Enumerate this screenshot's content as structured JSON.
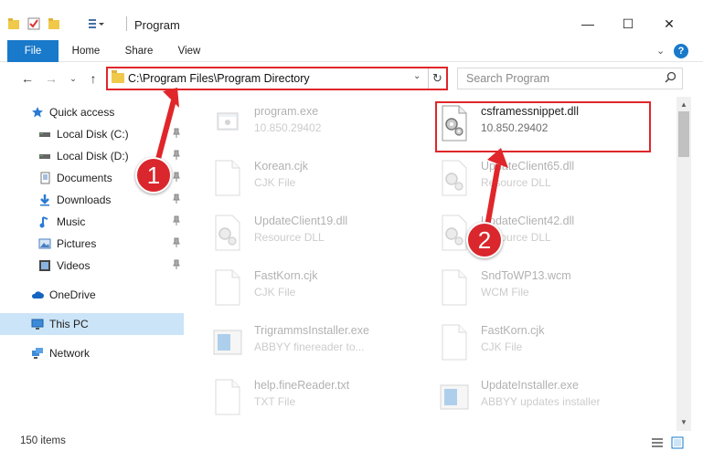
{
  "window": {
    "title": "Program",
    "controls": {
      "minimize": "—",
      "maximize": "☐",
      "close": "✕"
    }
  },
  "ribbon": {
    "tabs": [
      {
        "label": "File"
      },
      {
        "label": "Home"
      },
      {
        "label": "Share"
      },
      {
        "label": "View"
      }
    ],
    "help": "?"
  },
  "address_bar": {
    "path": "C:\\Program Files\\Program Directory"
  },
  "search": {
    "placeholder": "Search Program"
  },
  "sidebar": {
    "items": [
      {
        "label": "Quick access",
        "icon": "star-icon"
      },
      {
        "label": "Local Disk (C:)",
        "icon": "drive-icon",
        "pinned": true
      },
      {
        "label": "Local Disk (D:)",
        "icon": "drive-icon",
        "pinned": true
      },
      {
        "label": "Documents",
        "icon": "documents-icon",
        "pinned": true
      },
      {
        "label": "Downloads",
        "icon": "download-icon",
        "pinned": true
      },
      {
        "label": "Music",
        "icon": "music-icon",
        "pinned": true
      },
      {
        "label": "Pictures",
        "icon": "pictures-icon",
        "pinned": true
      },
      {
        "label": "Videos",
        "icon": "videos-icon",
        "pinned": true
      },
      {
        "label": "OneDrive",
        "icon": "cloud-icon"
      },
      {
        "label": "This PC",
        "icon": "computer-icon",
        "selected": true
      },
      {
        "label": "Network",
        "icon": "network-icon"
      }
    ]
  },
  "files": [
    {
      "name": "program.exe",
      "desc": "10.850.29402",
      "icon": "exe-icon",
      "faded": true
    },
    {
      "name": "csframessnippet.dll",
      "desc": "10.850.29402",
      "icon": "dll-gear-icon",
      "faded": false,
      "highlighted": true
    },
    {
      "name": "Korean.cjk",
      "desc": "CJK File",
      "icon": "blank-file-icon",
      "faded": true
    },
    {
      "name": "UpdateClient65.dll",
      "desc": "Resource DLL",
      "icon": "dll-gear-icon",
      "faded": true
    },
    {
      "name": "UpdateClient19.dll",
      "desc": "Resource DLL",
      "icon": "dll-gear-icon",
      "faded": true
    },
    {
      "name": "UpdateClient42.dll",
      "desc": "Resource DLL",
      "icon": "dll-gear-icon",
      "faded": true
    },
    {
      "name": "FastKorn.cjk",
      "desc": "CJK File",
      "icon": "blank-file-icon",
      "faded": true
    },
    {
      "name": "SndToWP13.wcm",
      "desc": "WCM File",
      "icon": "blank-file-icon",
      "faded": true
    },
    {
      "name": "TrigrammsInstaller.exe",
      "desc": "ABBYY finereader to...",
      "icon": "installer-icon",
      "faded": true
    },
    {
      "name": "FastKorn.cjk",
      "desc": "CJK File",
      "icon": "blank-file-icon",
      "faded": true
    },
    {
      "name": "help.fineReader.txt",
      "desc": "TXT File",
      "icon": "text-file-icon",
      "faded": true
    },
    {
      "name": "UpdateInstaller.exe",
      "desc": "ABBYY updates installer",
      "icon": "installer-icon",
      "faded": true
    }
  ],
  "status": {
    "item_count": "150 items"
  },
  "callouts": [
    {
      "label": "1"
    },
    {
      "label": "2"
    }
  ],
  "colors": {
    "accent": "#1979ca",
    "callout_red": "#e0262a",
    "selected_bg": "#cce4f7"
  }
}
